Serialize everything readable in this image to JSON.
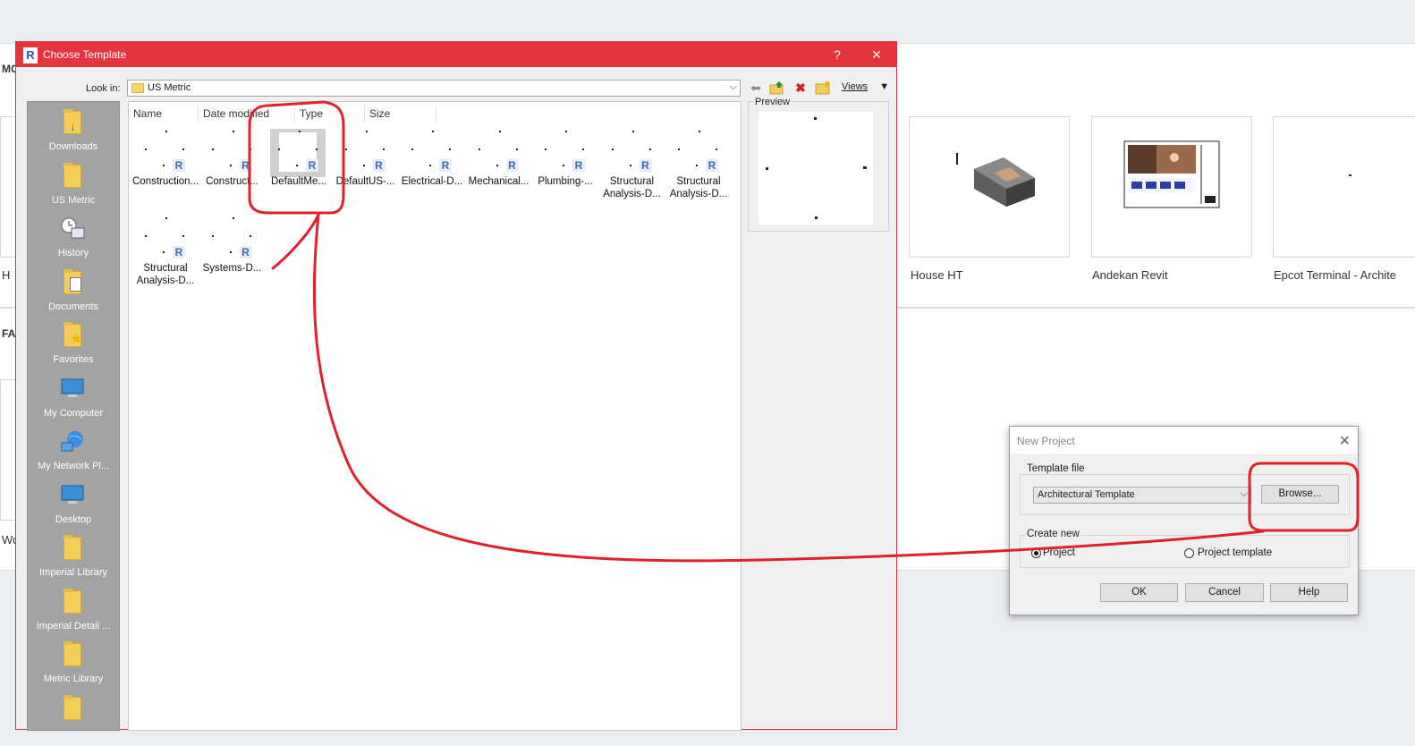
{
  "background": {
    "section_top_fragment": "MO",
    "section_bottom_fragment": "FA",
    "left_label_fragment_top": "H",
    "left_label_fragment_bottom": "Wo",
    "recent_projects": [
      {
        "label": "House HT"
      },
      {
        "label": "Andekan Revit"
      },
      {
        "label": "Epcot Terminal - Archite"
      }
    ]
  },
  "choose_template": {
    "title": "Choose Template",
    "help_glyph": "?",
    "close_glyph": "✕",
    "look_in_label": "Look in:",
    "look_in_value": "US Metric",
    "views_label": "Views",
    "columns": [
      "Name",
      "Date modified",
      "Type",
      "Size"
    ],
    "preview_label": "Preview",
    "places": [
      {
        "label": "Downloads",
        "icon": "downloads-folder-icon"
      },
      {
        "label": "US Metric",
        "icon": "folder-icon"
      },
      {
        "label": "History",
        "icon": "history-icon"
      },
      {
        "label": "Documents",
        "icon": "documents-icon"
      },
      {
        "label": "Favorites",
        "icon": "favorites-icon"
      },
      {
        "label": "My Computer",
        "icon": "computer-icon"
      },
      {
        "label": "My Network Pl...",
        "icon": "network-icon"
      },
      {
        "label": "Desktop",
        "icon": "desktop-icon"
      },
      {
        "label": "Imperial Library",
        "icon": "folder-icon"
      },
      {
        "label": "Imperial Detail ...",
        "icon": "folder-icon"
      },
      {
        "label": "Metric Library",
        "icon": "folder-icon"
      },
      {
        "label": "",
        "icon": "folder-icon"
      }
    ],
    "files": [
      {
        "name": "Construction..."
      },
      {
        "name": "Construct..."
      },
      {
        "name": "DefaultMe...",
        "selected": true
      },
      {
        "name": "DefaultUS-..."
      },
      {
        "name": "Electrical-D..."
      },
      {
        "name": "Mechanical..."
      },
      {
        "name": "Plumbing-..."
      },
      {
        "name": "Structural Analysis-D..."
      },
      {
        "name": "Structural Analysis-D..."
      },
      {
        "name": "Structural Analysis-D..."
      },
      {
        "name": "Systems-D..."
      }
    ],
    "file_badge": "R"
  },
  "new_project": {
    "title": "New Project",
    "close_glyph": "✕",
    "template_file_label": "Template file",
    "template_value": "Architectural Template",
    "browse_label": "Browse...",
    "create_new_label": "Create new",
    "option_project": "Project",
    "option_project_template": "Project template",
    "selected_option": "Project",
    "ok_label": "OK",
    "cancel_label": "Cancel",
    "help_label": "Help"
  },
  "colors": {
    "titlebar": "#e5343d",
    "annotation": "#e0202a",
    "places_bar": "#a3a3a3"
  }
}
